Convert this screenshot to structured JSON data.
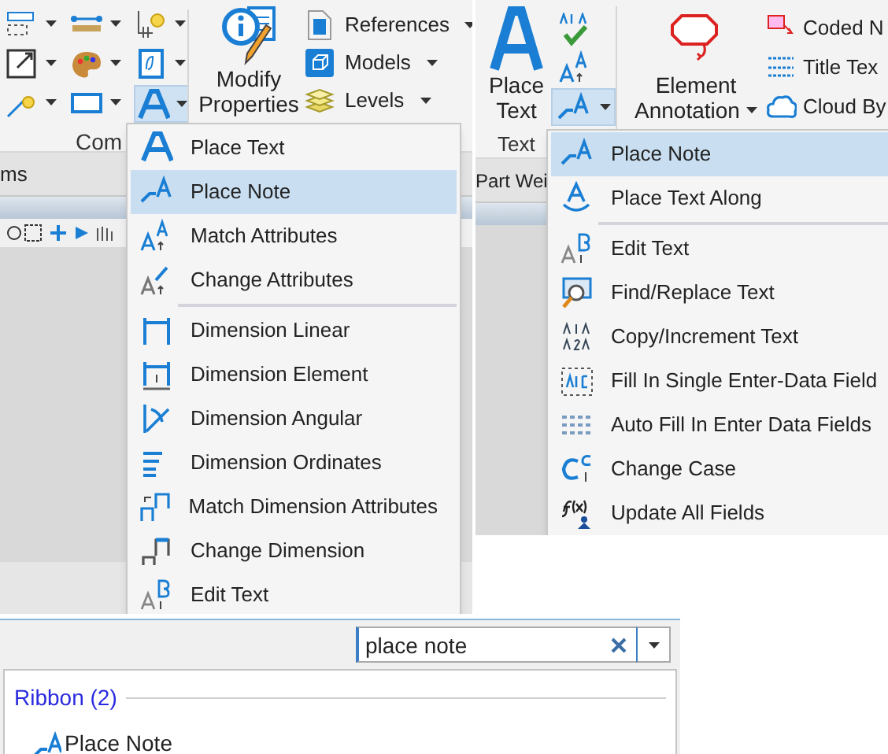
{
  "left_panel": {
    "ribbon": {
      "text_dropdown": {
        "open": true
      },
      "modify_button": {
        "label": "Modify Properties"
      },
      "list_buttons": [
        {
          "label": "References"
        },
        {
          "label": "Models"
        },
        {
          "label": "Levels"
        }
      ],
      "group_label": "Com"
    },
    "tab_strip": {
      "tab": "ms"
    },
    "menu": {
      "sections": [
        [
          {
            "label": "Place Text",
            "selected": false
          },
          {
            "label": "Place Note",
            "selected": true
          },
          {
            "label": "Match Attributes",
            "selected": false
          },
          {
            "label": "Change Attributes",
            "selected": false
          }
        ],
        [
          {
            "label": "Dimension Linear",
            "selected": false
          },
          {
            "label": "Dimension Element",
            "selected": false
          },
          {
            "label": "Dimension Angular",
            "selected": false
          },
          {
            "label": "Dimension Ordinates",
            "selected": false
          },
          {
            "label": "Match Dimension Attributes",
            "selected": false
          },
          {
            "label": "Change Dimension",
            "selected": false
          },
          {
            "label": "Edit Text",
            "selected": false
          }
        ]
      ]
    }
  },
  "right_panel": {
    "ribbon": {
      "place_text_button": {
        "label": "Place Text"
      },
      "note_dropdown": {
        "open": true
      },
      "annotation_button": {
        "label": "Element Annotation"
      },
      "list_buttons": [
        {
          "label": "Coded N"
        },
        {
          "label": "Title Tex"
        },
        {
          "label": "Cloud By"
        }
      ],
      "group_label": "Text"
    },
    "tab_strip": {
      "tab": "Part Wei"
    },
    "menu": {
      "sections": [
        [
          {
            "label": "Place Note",
            "selected": true
          },
          {
            "label": "Place Text Along",
            "selected": false
          }
        ],
        [
          {
            "label": "Edit Text",
            "selected": false
          },
          {
            "label": "Find/Replace Text",
            "selected": false
          },
          {
            "label": "Copy/Increment Text",
            "selected": false
          },
          {
            "label": "Fill In Single Enter-Data Field",
            "selected": false
          },
          {
            "label": "Auto Fill In Enter Data Fields",
            "selected": false
          },
          {
            "label": "Change Case",
            "selected": false
          },
          {
            "label": "Update All Fields",
            "selected": false
          }
        ]
      ]
    }
  },
  "search_panel": {
    "search": {
      "value": "place note"
    },
    "results": {
      "group": "Ribbon (2)",
      "items": [
        {
          "label": "Place Note"
        }
      ]
    }
  }
}
